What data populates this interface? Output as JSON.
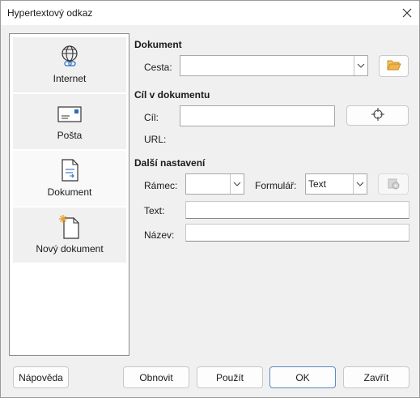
{
  "window": {
    "title": "Hypertextový odkaz"
  },
  "sidebar": {
    "items": [
      {
        "label": "Internet",
        "icon": "globe-link-icon"
      },
      {
        "label": "Pošta",
        "icon": "mail-envelope-icon"
      },
      {
        "label": "Dokument",
        "icon": "document-icon"
      },
      {
        "label": "Nový dokument",
        "icon": "new-document-icon"
      }
    ],
    "active_index": 2
  },
  "document_section": {
    "title": "Dokument",
    "path_label": "Cesta:",
    "path_value": ""
  },
  "target_section": {
    "title": "Cíl v dokumentu",
    "target_label": "Cíl:",
    "target_value": "",
    "url_label": "URL:",
    "url_value": ""
  },
  "more_settings": {
    "title": "Další nastavení",
    "frame_label": "Rámec:",
    "frame_value": "",
    "form_label": "Formulář:",
    "form_value": "Text",
    "text_label": "Text:",
    "text_value": "",
    "name_label": "Název:",
    "name_value": ""
  },
  "footer": {
    "help": "Nápověda",
    "reset": "Obnovit",
    "apply": "Použít",
    "ok": "OK",
    "close": "Zavřít"
  },
  "colors": {
    "accent": "#5a8ac6",
    "folder": "#e8a23a"
  }
}
